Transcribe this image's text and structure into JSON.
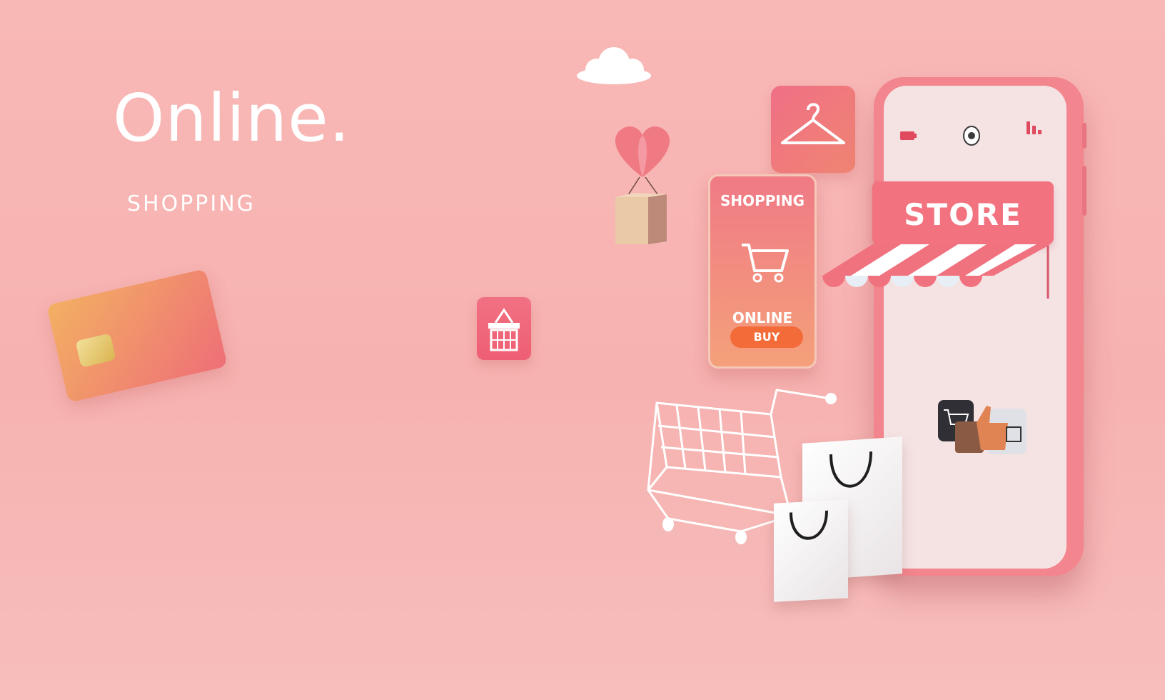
{
  "headline": {
    "title": "Online.",
    "subtitle": "SHOPPING"
  },
  "promo_card": {
    "title": "SHOPPING",
    "online_label": "ONLINE",
    "buy_label": "BUY",
    "icon": "shopping-cart-icon"
  },
  "store": {
    "sign_label": "STORE"
  },
  "icons": {
    "hanger": "hanger-icon",
    "basket": "basket-icon",
    "cloud": "cloud-icon",
    "balloon": "heart-balloon-icon",
    "credit_card": "credit-card-icon",
    "cart": "shopping-cart-icon",
    "bags": "shopping-bag-icon"
  },
  "colors": {
    "background": "#f7b7b5",
    "accent": "#f2727f",
    "phone_body": "#f3858e",
    "phone_screen": "#f5e3e4",
    "buy_button": "#f36b39",
    "card_gradient_start": "#f3b063",
    "card_gradient_end": "#ee6f77"
  }
}
